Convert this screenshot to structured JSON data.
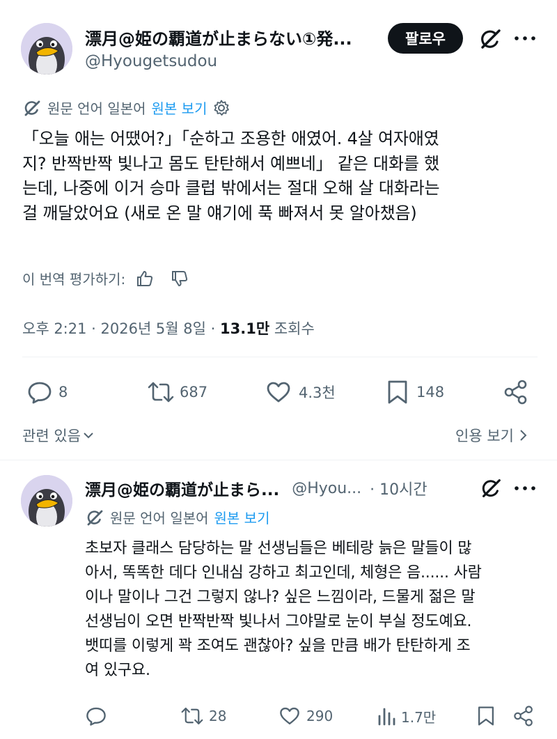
{
  "post": {
    "author_name": "漂月@姫の覇道が止まらない①発...",
    "author_handle": "@Hyougetsudou",
    "follow_label": "팔로우",
    "translation": {
      "source_label": "원문 언어 일본어",
      "view_original": "원본 보기"
    },
    "text_lines": [
      "「오늘 애는 어땠어?」「순하고 조용한 애였어. 4살 여자애였",
      "지? 반짝반짝 빛나고 몸도 탄탄해서 예쁘네」  같은 대화를 했",
      "는데, 나중에 이거 승마 클럽 밖에서는 절대 오해 살 대화라는",
      "걸 깨달았어요 (새로 온 말 얘기에 푹 빠져서 못 알아챘음)"
    ],
    "rate_label": "이 번역 평가하기:",
    "timestamp": "오후 2:21 · 2026년 5월 8일 ·",
    "views_count": "13.1만",
    "views_label": "조회수",
    "actions": {
      "replies": "8",
      "reposts": "687",
      "likes": "4.3천",
      "bookmarks": "148"
    },
    "related_label": "관련 있음",
    "quote_label": "인용 보기"
  },
  "reply": {
    "author_name": "漂月@姫の覇道が止まら...",
    "author_handle": "@Hyou...",
    "time": "· 10시간",
    "translation": {
      "source_label": "원문 언어 일본어",
      "view_original": "원본 보기"
    },
    "text_lines": [
      "초보자 클래스 담당하는 말 선생님들은 베테랑 늙은 말들이 많",
      "아서, 똑똑한 데다 인내심 강하고 최고인데, 체형은 음...... 사람",
      "이나 말이나 그건 그렇지 않나? 싶은 느낌이라, 드물게 젊은 말",
      "선생님이 오면 반짝반짝 빛나서 그야말로 눈이 부실 정도예요.",
      "뱃띠를 이렇게 꽉 조여도 괜찮아? 싶을 만큼 배가 탄탄하게 조",
      "여 있구요."
    ],
    "actions": {
      "replies": "",
      "reposts": "28",
      "likes": "290",
      "views": "1.7만"
    }
  },
  "colors": {
    "text": "#0f1419",
    "secondary": "#536471",
    "link": "#1d9bf0",
    "divider": "#eff3f4",
    "follow_bg": "#0f1419"
  },
  "icons": [
    "penguin-avatar",
    "grok-icon",
    "more-icon",
    "translate-icon",
    "gear-icon",
    "thumbs-up-icon",
    "thumbs-down-icon",
    "reply-icon",
    "repost-icon",
    "like-icon",
    "bookmark-icon",
    "share-icon",
    "chevron-down-icon",
    "chevron-right-icon",
    "views-icon"
  ]
}
